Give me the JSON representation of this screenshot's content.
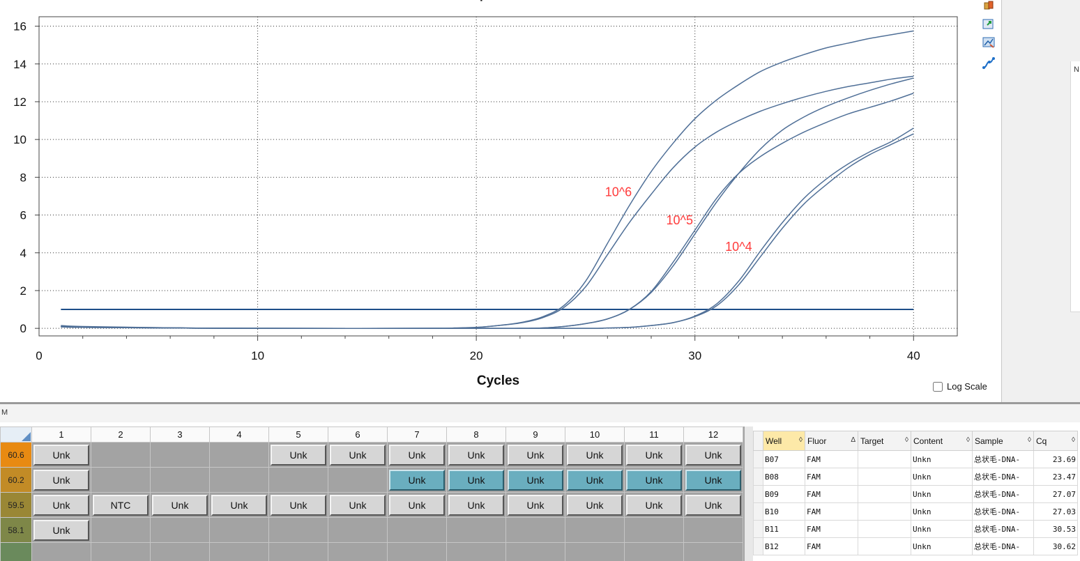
{
  "chart_data": {
    "type": "line",
    "title": "Amplification",
    "xlabel": "Cycles",
    "ylabel": "",
    "xlim": [
      0,
      42
    ],
    "ylim": [
      -0.4,
      16.5
    ],
    "x_ticks": [
      0,
      10,
      20,
      30,
      40
    ],
    "y_ticks": [
      0,
      2,
      4,
      6,
      8,
      10,
      12,
      14,
      16
    ],
    "grid": true,
    "threshold": 1.0,
    "series": [
      {
        "values": [
          [
            1,
            0.15
          ],
          [
            2,
            0.1
          ],
          [
            6,
            0.03
          ],
          [
            10,
            0.0
          ],
          [
            18,
            0.0
          ],
          [
            19,
            0.02
          ],
          [
            20,
            0.05
          ],
          [
            21,
            0.15
          ],
          [
            22,
            0.3
          ],
          [
            23,
            0.6
          ],
          [
            24,
            1.2
          ],
          [
            25,
            2.5
          ],
          [
            26,
            4.5
          ],
          [
            27,
            6.5
          ],
          [
            28,
            8.3
          ],
          [
            29,
            9.8
          ],
          [
            30,
            11.1
          ],
          [
            31,
            12.1
          ],
          [
            32,
            12.9
          ],
          [
            33,
            13.6
          ],
          [
            34,
            14.1
          ],
          [
            35,
            14.5
          ],
          [
            36,
            14.85
          ],
          [
            37,
            15.1
          ],
          [
            38,
            15.35
          ],
          [
            39,
            15.55
          ],
          [
            40,
            15.75
          ]
        ]
      },
      {
        "values": [
          [
            1,
            0.12
          ],
          [
            2,
            0.08
          ],
          [
            6,
            0.03
          ],
          [
            10,
            0.0
          ],
          [
            18,
            0.0
          ],
          [
            19,
            0.02
          ],
          [
            20,
            0.05
          ],
          [
            21,
            0.15
          ],
          [
            22,
            0.28
          ],
          [
            23,
            0.55
          ],
          [
            24,
            1.1
          ],
          [
            25,
            2.2
          ],
          [
            26,
            3.9
          ],
          [
            27,
            5.6
          ],
          [
            28,
            7.1
          ],
          [
            29,
            8.5
          ],
          [
            30,
            9.6
          ],
          [
            31,
            10.4
          ],
          [
            32,
            11.0
          ],
          [
            33,
            11.5
          ],
          [
            34,
            11.9
          ],
          [
            35,
            12.25
          ],
          [
            36,
            12.55
          ],
          [
            37,
            12.8
          ],
          [
            38,
            13.0
          ],
          [
            39,
            13.2
          ],
          [
            40,
            13.35
          ]
        ]
      },
      {
        "values": [
          [
            1,
            0.1
          ],
          [
            2,
            0.06
          ],
          [
            6,
            0.02
          ],
          [
            10,
            0.0
          ],
          [
            20,
            0.0
          ],
          [
            22,
            0.0
          ],
          [
            23,
            0.02
          ],
          [
            24,
            0.1
          ],
          [
            25,
            0.25
          ],
          [
            26,
            0.5
          ],
          [
            27,
            1.0
          ],
          [
            28,
            1.9
          ],
          [
            29,
            3.3
          ],
          [
            30,
            5.0
          ],
          [
            31,
            6.7
          ],
          [
            32,
            8.2
          ],
          [
            33,
            9.5
          ],
          [
            34,
            10.5
          ],
          [
            35,
            11.2
          ],
          [
            36,
            11.75
          ],
          [
            37,
            12.2
          ],
          [
            38,
            12.6
          ],
          [
            39,
            12.95
          ],
          [
            40,
            13.25
          ]
        ]
      },
      {
        "values": [
          [
            1,
            0.1
          ],
          [
            2,
            0.06
          ],
          [
            6,
            0.02
          ],
          [
            10,
            0.0
          ],
          [
            20,
            0.0
          ],
          [
            22,
            0.0
          ],
          [
            23,
            0.02
          ],
          [
            24,
            0.1
          ],
          [
            25,
            0.25
          ],
          [
            26,
            0.5
          ],
          [
            27,
            1.0
          ],
          [
            28,
            1.95
          ],
          [
            29,
            3.5
          ],
          [
            30,
            5.2
          ],
          [
            31,
            6.9
          ],
          [
            32,
            8.2
          ],
          [
            33,
            9.1
          ],
          [
            34,
            9.8
          ],
          [
            35,
            10.4
          ],
          [
            36,
            10.9
          ],
          [
            37,
            11.35
          ],
          [
            38,
            11.7
          ],
          [
            39,
            12.05
          ],
          [
            40,
            12.45
          ]
        ]
      },
      {
        "values": [
          [
            1,
            0.08
          ],
          [
            2,
            0.05
          ],
          [
            6,
            0.02
          ],
          [
            10,
            0.0
          ],
          [
            20,
            0.0
          ],
          [
            25,
            0.0
          ],
          [
            26,
            0.02
          ],
          [
            27,
            0.05
          ],
          [
            28,
            0.15
          ],
          [
            29,
            0.3
          ],
          [
            30,
            0.65
          ],
          [
            31,
            1.3
          ],
          [
            32,
            2.5
          ],
          [
            33,
            4.1
          ],
          [
            34,
            5.6
          ],
          [
            35,
            6.9
          ],
          [
            36,
            7.9
          ],
          [
            37,
            8.7
          ],
          [
            38,
            9.35
          ],
          [
            39,
            9.9
          ],
          [
            40,
            10.6
          ]
        ]
      },
      {
        "values": [
          [
            1,
            0.08
          ],
          [
            2,
            0.05
          ],
          [
            6,
            0.02
          ],
          [
            10,
            0.0
          ],
          [
            20,
            0.0
          ],
          [
            25,
            0.0
          ],
          [
            26,
            0.02
          ],
          [
            27,
            0.05
          ],
          [
            28,
            0.15
          ],
          [
            29,
            0.3
          ],
          [
            30,
            0.62
          ],
          [
            31,
            1.2
          ],
          [
            32,
            2.3
          ],
          [
            33,
            3.8
          ],
          [
            34,
            5.3
          ],
          [
            35,
            6.6
          ],
          [
            36,
            7.6
          ],
          [
            37,
            8.5
          ],
          [
            38,
            9.2
          ],
          [
            39,
            9.75
          ],
          [
            40,
            10.3
          ]
        ]
      }
    ],
    "annotations": [
      {
        "text": "10^6",
        "x": 26.5,
        "y": 7.0
      },
      {
        "text": "10^5",
        "x": 29.3,
        "y": 5.5
      },
      {
        "text": "10^4",
        "x": 32.0,
        "y": 4.1
      }
    ],
    "colors": {
      "line": "#4f6f97",
      "threshold": "#1d4e89",
      "annotation": "#ff3b3b",
      "grid": "#333333"
    }
  },
  "toolbar_icons": [
    "copy-icon",
    "export-icon",
    "chart-settings-icon",
    "curve-icon"
  ],
  "log_scale_label": "Log Scale",
  "log_scale_checked": false,
  "side_panel_letter": "N",
  "mode_bar_text": "M",
  "plate": {
    "columns": [
      "1",
      "2",
      "3",
      "4",
      "5",
      "6",
      "7",
      "8",
      "9",
      "10",
      "11",
      "12"
    ],
    "rows": [
      {
        "temp": "60.6",
        "temp_color": "#e88a12",
        "wells": [
          "Unk",
          "",
          "",
          "",
          "Unk",
          "Unk",
          "Unk",
          "Unk",
          "Unk",
          "Unk",
          "Unk",
          "Unk"
        ],
        "selected": []
      },
      {
        "temp": "60.2",
        "temp_color": "#c28b26",
        "wells": [
          "Unk",
          "",
          "",
          "",
          "",
          "",
          "Unk",
          "Unk",
          "Unk",
          "Unk",
          "Unk",
          "Unk"
        ],
        "selected": [
          6,
          7,
          8,
          9,
          10,
          11
        ]
      },
      {
        "temp": "59.5",
        "temp_color": "#9a8735",
        "wells": [
          "Unk",
          "NTC",
          "Unk",
          "Unk",
          "Unk",
          "Unk",
          "Unk",
          "Unk",
          "Unk",
          "Unk",
          "Unk",
          "Unk"
        ],
        "selected": []
      },
      {
        "temp": "58.1",
        "temp_color": "#7e8748",
        "wells": [
          "Unk",
          "",
          "",
          "",
          "",
          "",
          "",
          "",
          "",
          "",
          "",
          ""
        ],
        "selected": []
      },
      {
        "temp": "",
        "temp_color": "#6a8a5c",
        "wells": [
          "",
          "",
          "",
          "",
          "",
          "",
          "",
          "",
          "",
          "",
          "",
          ""
        ],
        "selected": []
      }
    ]
  },
  "results": {
    "headers": [
      {
        "label": "Well",
        "sort": "◊"
      },
      {
        "label": "Fluor",
        "sort": "Δ"
      },
      {
        "label": "Target",
        "sort": "◊"
      },
      {
        "label": "Content",
        "sort": "◊"
      },
      {
        "label": "Sample",
        "sort": "◊"
      },
      {
        "label": "Cq",
        "sort": "◊"
      }
    ],
    "rows": [
      {
        "well": "B07",
        "fluor": "FAM",
        "target": "",
        "content": "Unkn",
        "sample": "总状毛-DNA-",
        "cq": "23.69"
      },
      {
        "well": "B08",
        "fluor": "FAM",
        "target": "",
        "content": "Unkn",
        "sample": "总状毛-DNA-",
        "cq": "23.47"
      },
      {
        "well": "B09",
        "fluor": "FAM",
        "target": "",
        "content": "Unkn",
        "sample": "总状毛-DNA-",
        "cq": "27.07"
      },
      {
        "well": "B10",
        "fluor": "FAM",
        "target": "",
        "content": "Unkn",
        "sample": "总状毛-DNA-",
        "cq": "27.03"
      },
      {
        "well": "B11",
        "fluor": "FAM",
        "target": "",
        "content": "Unkn",
        "sample": "总状毛-DNA-",
        "cq": "30.53"
      },
      {
        "well": "B12",
        "fluor": "FAM",
        "target": "",
        "content": "Unkn",
        "sample": "总状毛-DNA-",
        "cq": "30.62"
      }
    ]
  }
}
